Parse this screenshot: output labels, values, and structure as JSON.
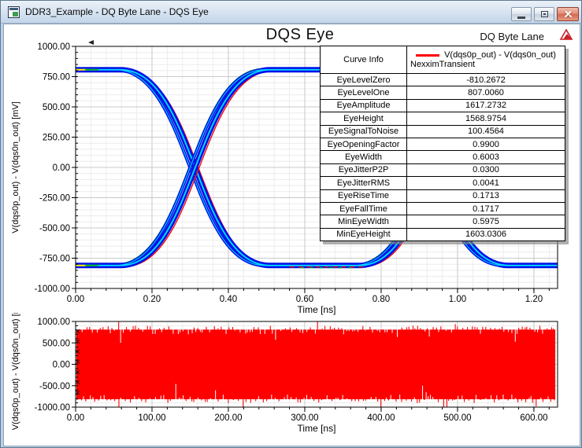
{
  "window": {
    "title": "DDR3_Example - DQ Byte Lane - DQS Eye"
  },
  "report": {
    "title": "DQS Eye",
    "context_label": "DQ Byte Lane"
  },
  "curve_info_table": {
    "header": "Curve Info",
    "trace": {
      "name": "V(dqs0p_out) - V(dqs0n_out)",
      "solution": "NexximTransient",
      "color": "#ff0000"
    },
    "rows": [
      {
        "label": "EyeLevelZero",
        "value": "-810.2672"
      },
      {
        "label": "EyeLevelOne",
        "value": "807.0060"
      },
      {
        "label": "EyeAmplitude",
        "value": "1617.2732"
      },
      {
        "label": "EyeHeight",
        "value": "1568.9754"
      },
      {
        "label": "EyeSignalToNoise",
        "value": "100.4564"
      },
      {
        "label": "EyeOpeningFactor",
        "value": "0.9900"
      },
      {
        "label": "EyeWidth",
        "value": "0.6003"
      },
      {
        "label": "EyeJitterP2P",
        "value": "0.0300"
      },
      {
        "label": "EyeJitterRMS",
        "value": "0.0041"
      },
      {
        "label": "EyeRiseTime",
        "value": "0.1713"
      },
      {
        "label": "EyeFallTime",
        "value": "0.1717"
      },
      {
        "label": "MinEyeWidth",
        "value": "0.5975"
      },
      {
        "label": "MinEyeHeight",
        "value": "1603.0306"
      }
    ]
  },
  "chart_data": [
    {
      "type": "line",
      "variant": "eye-diagram",
      "title": "DQS Eye",
      "xlabel": "Time [ns]",
      "ylabel": "V(dqs0p_out) - V(dqs0n_out) [mV]",
      "xlim": [
        0,
        1.262
      ],
      "ylim": [
        -1000,
        1000
      ],
      "xticks": [
        0,
        0.2,
        0.4,
        0.6,
        0.8,
        1.0,
        1.2
      ],
      "xtick_labels": [
        "0.00",
        "0.20",
        "0.40",
        "0.60",
        "0.80",
        "1.00",
        "1.20"
      ],
      "x_minor_step": 0.04,
      "yticks": [
        1000,
        750,
        500,
        250,
        0,
        -250,
        -500,
        -750,
        -1000
      ],
      "ytick_labels": [
        "1000.00",
        "750.00",
        "500.00",
        "250.00",
        "0.00",
        "-250.00",
        "-500.00",
        "-750.00",
        "-1000.00"
      ],
      "y_minor_step": 50,
      "grid": true,
      "legend_position": "overlay-table",
      "series": [
        {
          "name": "V(dqs0p_out) - V(dqs0n_out)",
          "solution": "NexximTransient",
          "colors": {
            "band": "#0011e8",
            "core": "#00e2ff",
            "edge": "#ff0000",
            "accent_green": "#00bb22",
            "accent_yellow": "#ffee00"
          }
        }
      ],
      "eye": {
        "level_one_mV": 807.006,
        "level_zero_mV": -810.2672,
        "crossing_times_ns": [
          0.31,
          0.935
        ],
        "transition_halfwidth_ns": 0.196,
        "jitter_p2p_ns": 0.03,
        "eye_width_ns": 0.6003,
        "eye_height_mV": 1568.9754
      }
    },
    {
      "type": "line",
      "variant": "dense-transient",
      "xlabel": "Time [ns]",
      "ylabel": "V(dqs0p_out) - V(dqs0n_out) [mV]",
      "xlim": [
        0,
        631
      ],
      "ylim": [
        -1000,
        1000
      ],
      "xticks": [
        0,
        100,
        200,
        300,
        400,
        500,
        600
      ],
      "xtick_labels": [
        "0.00",
        "100.00",
        "200.00",
        "300.00",
        "400.00",
        "500.00",
        "600.00"
      ],
      "x_minor_step": 20,
      "yticks": [
        1000,
        500,
        0,
        -500,
        -1000
      ],
      "ytick_labels": [
        "1000.00",
        "500.00",
        "0.00",
        "-500.00",
        "-1000.00"
      ],
      "y_minor_step": 100,
      "grid": true,
      "signal": {
        "name": "V(dqs0p_out) - V(dqs0n_out)",
        "color": "#fe0000",
        "high_mV": 810,
        "low_mV": -815,
        "start_ns": 0,
        "end_ns": 628,
        "spike_max_mV": 960,
        "spike_min_mV": -980
      }
    }
  ]
}
